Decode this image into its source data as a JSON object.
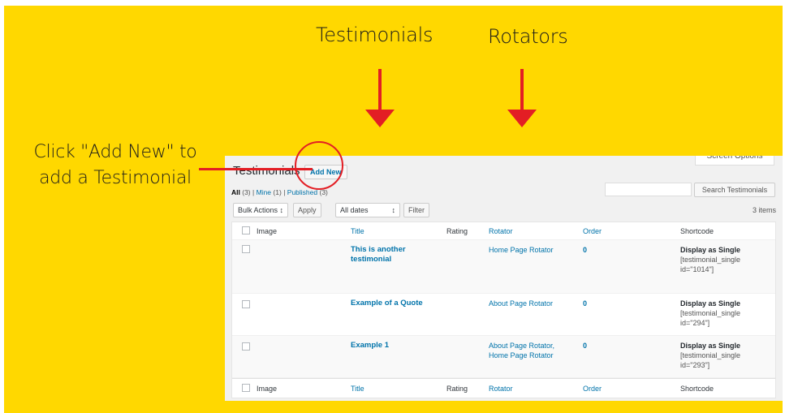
{
  "annotations": {
    "testimonials": "Testimonials",
    "rotators": "Rotators",
    "click_line1": "Click \"Add New\" to",
    "click_line2": "add a Testimonial"
  },
  "colors": {
    "background": "#ffd800",
    "arrow": "#e31e24",
    "link": "#0073aa"
  },
  "page": {
    "screen_options": "Screen Options",
    "title": "Testimonials",
    "add_new": "Add New",
    "views": {
      "all": "All",
      "all_count": "(3)",
      "mine": "Mine",
      "mine_count": "(1)",
      "published": "Published",
      "published_count": "(3)",
      "sep": "|"
    },
    "search_button": "Search Testimonials",
    "bulk_actions": "Bulk Actions ↕",
    "apply": "Apply",
    "dates": "All dates",
    "dates_arrow": "↕",
    "filter": "Filter",
    "items_count": "3 items"
  },
  "table": {
    "columns": {
      "image": "Image",
      "title": "Title",
      "rating": "Rating",
      "rotator": "Rotator",
      "order": "Order",
      "shortcode": "Shortcode"
    },
    "rows": [
      {
        "title_line1": "This is another",
        "title_line2": "testimonial",
        "rotator_line1": "Home Page Rotator",
        "rotator_line2": "",
        "order": "0",
        "display": "Display as Single",
        "code_line1": "[testimonial_single",
        "code_line2": "id=\"1014\"]"
      },
      {
        "title_line1": "Example of a Quote",
        "title_line2": "",
        "rotator_line1": "About Page Rotator",
        "rotator_line2": "",
        "order": "0",
        "display": "Display as Single",
        "code_line1": "[testimonial_single",
        "code_line2": "id=\"294\"]"
      },
      {
        "title_line1": "Example 1",
        "title_line2": "",
        "rotator_line1": "About Page Rotator,",
        "rotator_line2": "Home Page Rotator",
        "order": "0",
        "display": "Display as Single",
        "code_line1": "[testimonial_single",
        "code_line2": "id=\"293\"]"
      }
    ]
  }
}
